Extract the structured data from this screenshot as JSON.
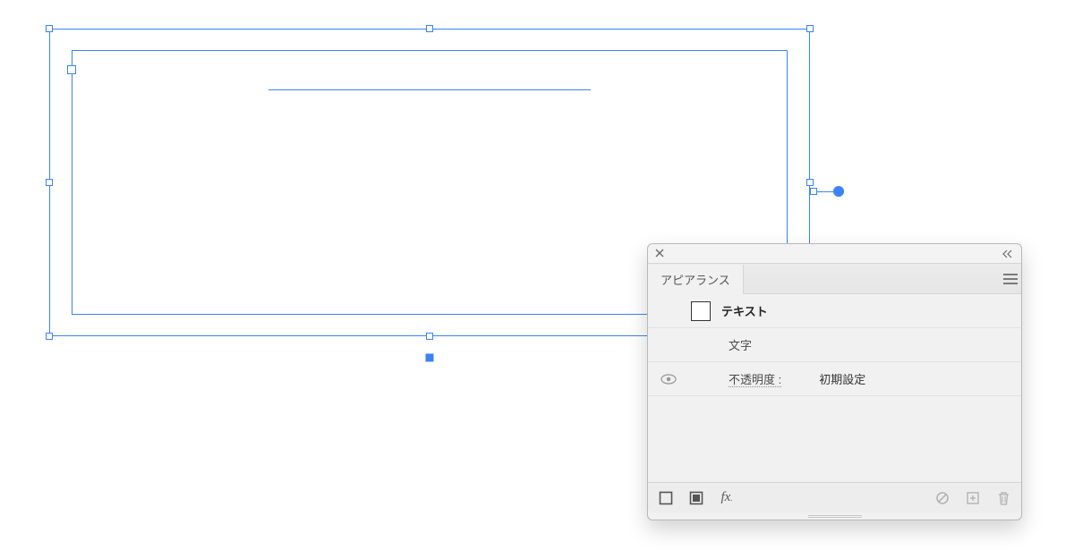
{
  "panel": {
    "tab_label": "アピアランス",
    "item_name": "テキスト",
    "char_label": "文字",
    "opacity_label": "不透明度 :",
    "opacity_value": "初期設定"
  }
}
